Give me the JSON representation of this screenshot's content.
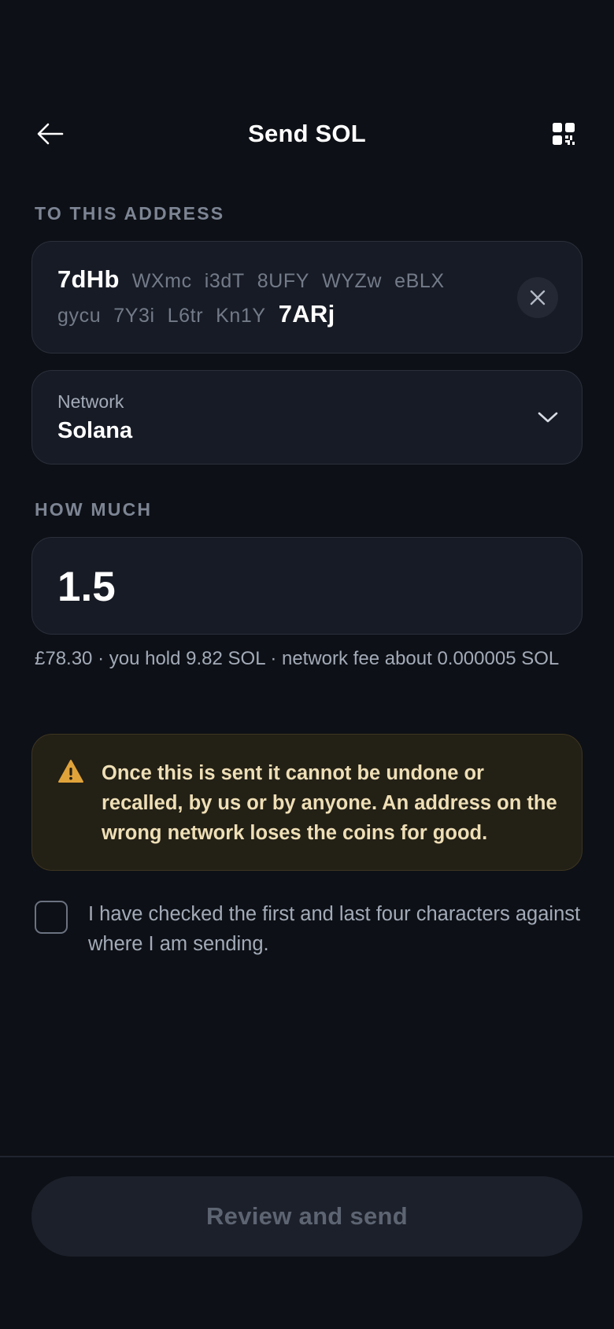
{
  "header": {
    "title": "Send SOL",
    "back_icon": "arrow-left-icon",
    "qr_icon": "qr-code-icon"
  },
  "address_section": {
    "label": "TO THIS ADDRESS",
    "lines": [
      [
        {
          "text": "7dHb",
          "emphasis": true
        },
        {
          "text": "WXmc",
          "emphasis": false
        },
        {
          "text": "i3dT",
          "emphasis": false
        },
        {
          "text": "8UFY",
          "emphasis": false
        },
        {
          "text": "WYZw",
          "emphasis": false
        },
        {
          "text": "eBLX",
          "emphasis": false
        }
      ],
      [
        {
          "text": "gycu",
          "emphasis": false
        },
        {
          "text": "7Y3i",
          "emphasis": false
        },
        {
          "text": "L6tr",
          "emphasis": false
        },
        {
          "text": "Kn1Y",
          "emphasis": false
        },
        {
          "text": "7ARj",
          "emphasis": true
        }
      ]
    ],
    "clear_icon": "close-icon"
  },
  "network": {
    "label": "Network",
    "value": "Solana",
    "chevron_icon": "chevron-down-icon"
  },
  "amount_section": {
    "label": "HOW MUCH",
    "value": "1.5",
    "hint": "£78.30 · you hold 9.82 SOL · network fee about 0.000005 SOL"
  },
  "warning": {
    "icon": "warning-triangle-icon",
    "text": "Once this is sent it cannot be undone or recalled, by us or by anyone. An address on the wrong network loses the coins for good."
  },
  "confirmation": {
    "checked": false,
    "label": "I have checked the first and last four characters against where I am sending."
  },
  "footer": {
    "button_label": "Review and send",
    "button_enabled": false
  },
  "colors": {
    "background": "#0d1016",
    "card": "#171b25",
    "card_border": "#2a2f3b",
    "muted_text": "#a3abb8",
    "section_label": "#7d8594",
    "warning_bg": "#232016",
    "warning_text": "#efdfb6",
    "warning_icon": "#e0a33a",
    "disabled_button_bg": "#1c202a",
    "disabled_button_text": "#5d6472"
  }
}
